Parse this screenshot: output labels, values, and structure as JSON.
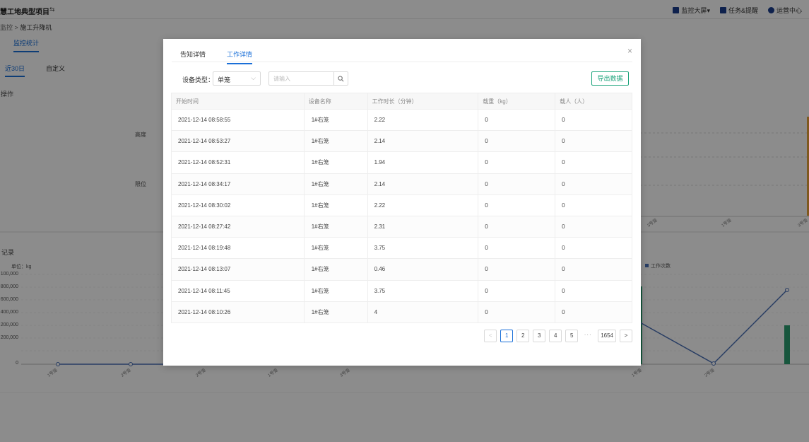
{
  "header": {
    "title": "慧工地典型项目",
    "actions": [
      {
        "label": "监控大屏",
        "icon": "monitor-icon"
      },
      {
        "label": "任务&提醒",
        "icon": "mail-icon"
      },
      {
        "label": "运营中心",
        "icon": "gear-icon"
      }
    ]
  },
  "breadcrumb": {
    "parent": "监控",
    "sep": ">",
    "current": "施工升降机"
  },
  "page": {
    "main_tab": "监控统计",
    "subtabs": [
      "近30日",
      "自定义"
    ],
    "section1_title": "操作",
    "radar_labels": [
      "高度",
      "限位"
    ],
    "section2_title": "记录",
    "unit_label": "单位：kg",
    "y_ticks": [
      "100,000",
      "800,000",
      "600,000",
      "400,000",
      "200,000",
      "200,000",
      "0"
    ],
    "legend_label": "工作次数",
    "bg_x_ticks": [
      "3号笼",
      "1号笼",
      "3号笼",
      "1号笼",
      "2号笼",
      "2号笼",
      "1号笼",
      "3号笼",
      "1号笼",
      "2号笼"
    ]
  },
  "modal": {
    "tabs": [
      "告知详情",
      "工作详情"
    ],
    "active_tab": 1,
    "close_glyph": "×",
    "filter_label": "设备类型：",
    "filter_value": "单笼",
    "search_placeholder": "请输入",
    "export_label": "导出数据",
    "columns": [
      "开始时间",
      "设备名称",
      "工作时长（分钟）",
      "载重（kg）",
      "载人（人）"
    ],
    "rows": [
      [
        "2021-12-14 08:58:55",
        "1#右笼",
        "2.22",
        "0",
        "0"
      ],
      [
        "2021-12-14 08:53:27",
        "1#右笼",
        "2.14",
        "0",
        "0"
      ],
      [
        "2021-12-14 08:52:31",
        "1#右笼",
        "1.94",
        "0",
        "0"
      ],
      [
        "2021-12-14 08:34:17",
        "1#右笼",
        "2.14",
        "0",
        "0"
      ],
      [
        "2021-12-14 08:30:02",
        "1#右笼",
        "2.22",
        "0",
        "0"
      ],
      [
        "2021-12-14 08:27:42",
        "1#右笼",
        "2.31",
        "0",
        "0"
      ],
      [
        "2021-12-14 08:19:48",
        "1#右笼",
        "3.75",
        "0",
        "0"
      ],
      [
        "2021-12-14 08:13:07",
        "1#右笼",
        "0.46",
        "0",
        "0"
      ],
      [
        "2021-12-14 08:11:45",
        "1#右笼",
        "3.75",
        "0",
        "0"
      ],
      [
        "2021-12-14 08:10:26",
        "1#右笼",
        "4",
        "0",
        "0"
      ]
    ],
    "pagination": {
      "prev": "<",
      "pages": [
        "1",
        "2",
        "3",
        "4",
        "5"
      ],
      "ellipsis": "···",
      "last": "1654",
      "next": ">",
      "current": "1"
    }
  },
  "colors": {
    "accent": "#1a6fd8",
    "export": "#1aa37a",
    "bar": "#2a9d6f",
    "line": "#4a6fb5",
    "orange": "#e8a33a"
  }
}
